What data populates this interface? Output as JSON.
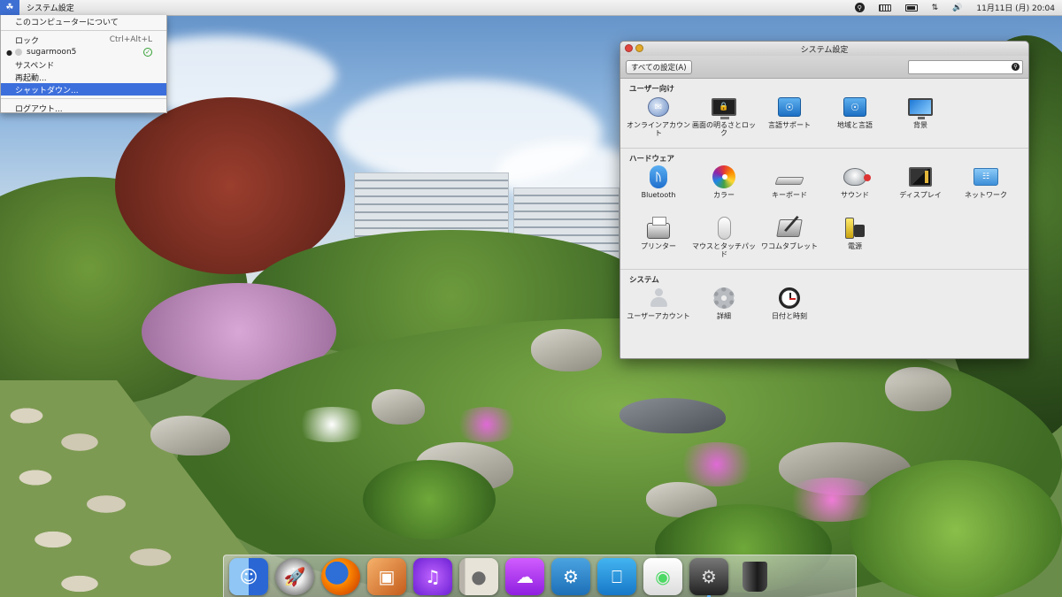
{
  "menubar": {
    "app_title": "システム設定",
    "status": {
      "time": "11月11日 (月) 20:04"
    }
  },
  "dropdown": {
    "about": "このコンピューターについて",
    "lock": "ロック",
    "lock_shortcut": "Ctrl+Alt+L",
    "user": "sugarmoon5",
    "suspend": "サスペンド",
    "restart": "再起動...",
    "shutdown": "シャットダウン...",
    "logout": "ログアウト..."
  },
  "window": {
    "title": "システム設定",
    "toolbar": {
      "show_all": "すべての設定(A)",
      "search_value": ""
    },
    "sections": {
      "personal": {
        "title": "ユーザー向け",
        "items": [
          {
            "label": "オンラインアカウント",
            "icon": "online-accounts-icon"
          },
          {
            "label": "画面の明るさとロック",
            "icon": "brightness-lock-icon"
          },
          {
            "label": "言語サポート",
            "icon": "language-support-icon"
          },
          {
            "label": "地域と言語",
            "icon": "region-language-icon"
          },
          {
            "label": "背景",
            "icon": "background-icon"
          }
        ]
      },
      "hardware": {
        "title": "ハードウェア",
        "items": [
          {
            "label": "Bluetooth",
            "icon": "bluetooth-icon"
          },
          {
            "label": "カラー",
            "icon": "color-icon"
          },
          {
            "label": "キーボード",
            "icon": "keyboard-icon"
          },
          {
            "label": "サウンド",
            "icon": "sound-icon"
          },
          {
            "label": "ディスプレイ",
            "icon": "display-icon"
          },
          {
            "label": "ネットワーク",
            "icon": "network-icon"
          },
          {
            "label": "プリンター",
            "icon": "printer-icon"
          },
          {
            "label": "マウスとタッチパッド",
            "icon": "mouse-icon"
          },
          {
            "label": "ワコムタブレット",
            "icon": "wacom-tablet-icon"
          },
          {
            "label": "電源",
            "icon": "power-icon"
          }
        ]
      },
      "system": {
        "title": "システム",
        "items": [
          {
            "label": "ユーザーアカウント",
            "icon": "user-accounts-icon"
          },
          {
            "label": "詳細",
            "icon": "details-icon"
          },
          {
            "label": "日付と時刻",
            "icon": "date-time-icon"
          }
        ]
      }
    }
  },
  "dock": {
    "items": [
      "finder-icon",
      "launchpad-icon",
      "firefox-icon",
      "photos-icon",
      "itunes-icon",
      "contacts-icon",
      "icloud-icon",
      "cydia-icon",
      "desktop-icon",
      "toggle-settings-icon",
      "system-preferences-icon",
      "trash-icon"
    ],
    "active": "system-preferences-icon"
  },
  "colors": {
    "accent": "#3d6fdc",
    "menubar": "#e8e8e8",
    "window_bg": "#ececec"
  }
}
